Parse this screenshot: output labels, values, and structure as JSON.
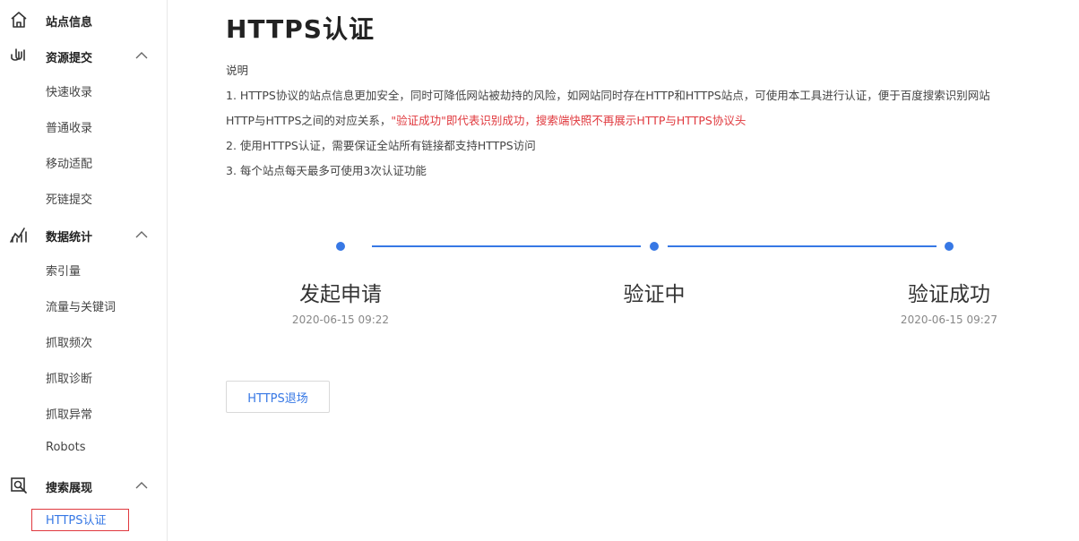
{
  "sidebar": {
    "site_info": {
      "label": "站点信息",
      "icon": "home-icon"
    },
    "resource": {
      "label": "资源提交",
      "icon": "link-icon",
      "items": [
        "快速收录",
        "普通收录",
        "移动适配",
        "死链提交"
      ]
    },
    "stats": {
      "label": "数据统计",
      "icon": "chart-icon",
      "items": [
        "索引量",
        "流量与关键词",
        "抓取频次",
        "抓取诊断",
        "抓取异常",
        "Robots"
      ]
    },
    "search": {
      "label": "搜索展现",
      "icon": "search-display-icon",
      "items": [
        "HTTPS认证"
      ]
    }
  },
  "main": {
    "title": "HTTPS认证",
    "desc_heading": "说明",
    "desc_line1": "1. HTTPS协议的站点信息更加安全，同时可降低网站被劫持的风险，如网站同时存在HTTP和HTTPS站点，可使用本工具进行认证，便于百度搜索识别网站",
    "desc_line2a": "HTTP与HTTPS之间的对应关系，",
    "desc_line2b": "\"验证成功\"即代表识别成功，搜索端快照不再展示HTTP与HTTPS协议头",
    "desc_line3": "2. 使用HTTPS认证，需要保证全站所有链接都支持HTTPS访问",
    "desc_line4": "3. 每个站点每天最多可使用3次认证功能",
    "steps": [
      {
        "label": "发起申请",
        "time": "2020-06-15 09:22"
      },
      {
        "label": "验证中",
        "time": ""
      },
      {
        "label": "验证成功",
        "time": "2020-06-15 09:27"
      }
    ],
    "exit_button": "HTTPS退场"
  },
  "colors": {
    "accent": "#3778e5",
    "highlight": "#e0393e"
  }
}
